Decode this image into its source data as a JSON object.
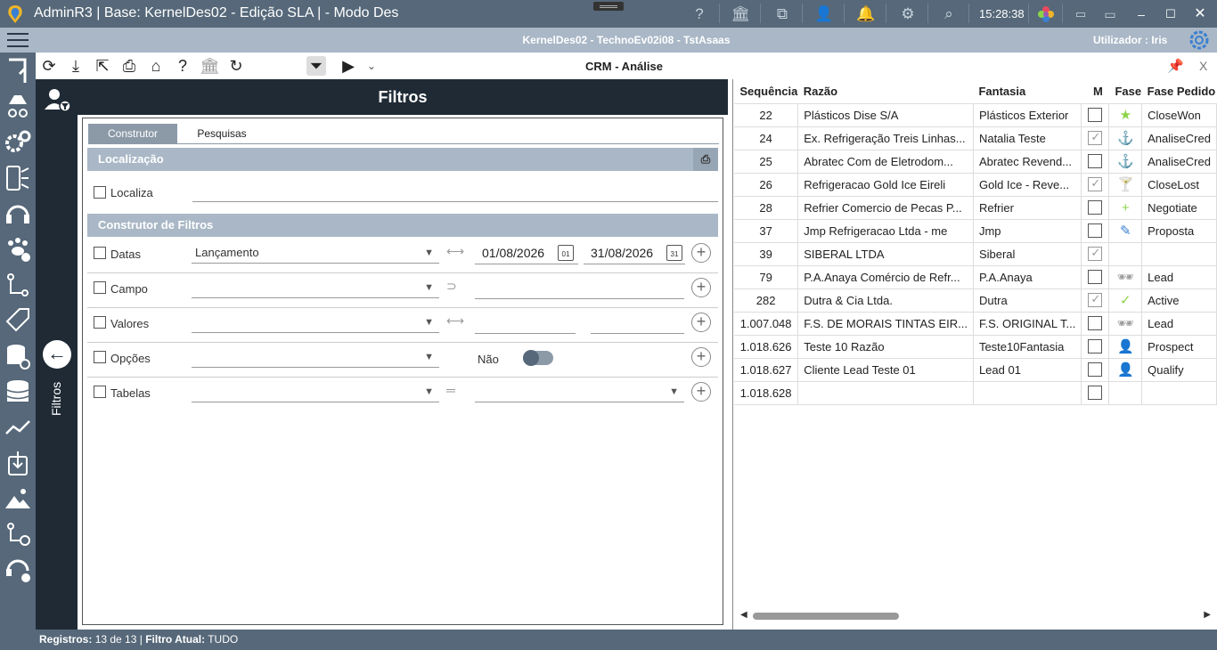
{
  "window": {
    "title": "AdminR3 | Base: KernelDes02 - Edição SLA | - Modo Des",
    "clock": "15:28:38"
  },
  "context_bar": {
    "context": "KernelDes02 - TechnoEv02i08 - TstAsaas",
    "user": "Utilizador : Iris"
  },
  "toolbar": {
    "title": "CRM - Análise"
  },
  "side_panel": {
    "label": "Filtros"
  },
  "filters": {
    "header": "Filtros",
    "tabs": [
      "Construtor",
      "Pesquisas"
    ],
    "section_location": "Localização",
    "locate_label": "Localiza",
    "section_builder": "Construtor de Filtros",
    "rows": {
      "dates": {
        "label": "Datas",
        "select": "Lançamento",
        "from": "01/08/2026",
        "to": "31/08/2026",
        "cal_day": "01",
        "cal_day2": "31"
      },
      "field": {
        "label": "Campo",
        "select": ""
      },
      "values": {
        "label": "Valores",
        "select": ""
      },
      "options": {
        "label": "Opções",
        "select": "",
        "toggle_label": "Não"
      },
      "tables": {
        "label": "Tabelas",
        "select": ""
      }
    }
  },
  "grid": {
    "columns": [
      "Sequência",
      "Razão",
      "Fantasia",
      "M",
      "Fase",
      "Fase Pedido"
    ],
    "rows": [
      {
        "seq": "22",
        "razao": "Plásticos Dise S/A",
        "fantasia": "Plásticos Exterior",
        "m": false,
        "fase_icon": "star-icon",
        "fase_color": "#8bd44a",
        "fase_pedido": "CloseWon"
      },
      {
        "seq": "24",
        "razao": "Ex. Refrigeração Treis Linhas...",
        "fantasia": "Natalia Teste",
        "m": true,
        "fase_icon": "anchor-icon",
        "fase_color": "#5aa0d8",
        "fase_pedido": "AnaliseCred"
      },
      {
        "seq": "25",
        "razao": "Abratec Com de Eletrodom...",
        "fantasia": "Abratec Revend...",
        "m": false,
        "fase_icon": "anchor-icon",
        "fase_color": "#5aa0d8",
        "fase_pedido": "AnaliseCred"
      },
      {
        "seq": "26",
        "razao": "Refrigeracao Gold Ice Eireli",
        "fantasia": "Gold Ice - Reve...",
        "m": true,
        "fase_icon": "glass-icon",
        "fase_color": "#444444",
        "fase_pedido": "CloseLost"
      },
      {
        "seq": "28",
        "razao": "Refrier Comercio de Pecas P...",
        "fantasia": "Refrier",
        "m": false,
        "fase_icon": "plus-icon",
        "fase_color": "#8bd44a",
        "fase_pedido": "Negotiate"
      },
      {
        "seq": "37",
        "razao": "Jmp Refrigeracao Ltda - me",
        "fantasia": "Jmp",
        "m": false,
        "fase_icon": "pen-icon",
        "fase_color": "#3a7fd0",
        "fase_pedido": "Proposta"
      },
      {
        "seq": "39",
        "razao": "SIBERAL LTDA",
        "fantasia": "Siberal",
        "m": true,
        "fase_icon": "",
        "fase_color": "",
        "fase_pedido": ""
      },
      {
        "seq": "79",
        "razao": "P.A.Anaya Comércio de Refr...",
        "fantasia": "P.A.Anaya",
        "m": false,
        "fase_icon": "spy-icon",
        "fase_color": "#999999",
        "fase_pedido": "Lead"
      },
      {
        "seq": "282",
        "razao": "Dutra & Cia Ltda.",
        "fantasia": "Dutra",
        "m": true,
        "fase_icon": "check-icon",
        "fase_color": "#8bd44a",
        "fase_pedido": "Active"
      },
      {
        "seq": "1.007.048",
        "razao": "F.S. DE MORAIS TINTAS EIR...",
        "fantasia": "F.S. ORIGINAL T...",
        "m": false,
        "fase_icon": "spy-icon",
        "fase_color": "#999999",
        "fase_pedido": "Lead"
      },
      {
        "seq": "1.018.626",
        "razao": "Teste 10 Razão",
        "fantasia": "Teste10Fantasia",
        "m": false,
        "fase_icon": "person-icon",
        "fase_color": "#5aa0d8",
        "fase_pedido": "Prospect"
      },
      {
        "seq": "1.018.627",
        "razao": "Cliente Lead Teste 01",
        "fantasia": "Lead 01",
        "m": false,
        "fase_icon": "person-filter-icon",
        "fase_color": "#3a7fd0",
        "fase_pedido": "Qualify"
      },
      {
        "seq": "1.018.628",
        "razao": "",
        "fantasia": "",
        "m": false,
        "fase_icon": "",
        "fase_color": "",
        "fase_pedido": ""
      }
    ]
  },
  "status": {
    "records_label": "Registros:",
    "records_value": "13 de 13",
    "filter_label": "Filtro Atual:",
    "filter_value": "TUDO"
  },
  "colors": {
    "titlebar": "#566879",
    "subbar": "#a9b7c6",
    "dark_panel": "#1f2a35"
  }
}
